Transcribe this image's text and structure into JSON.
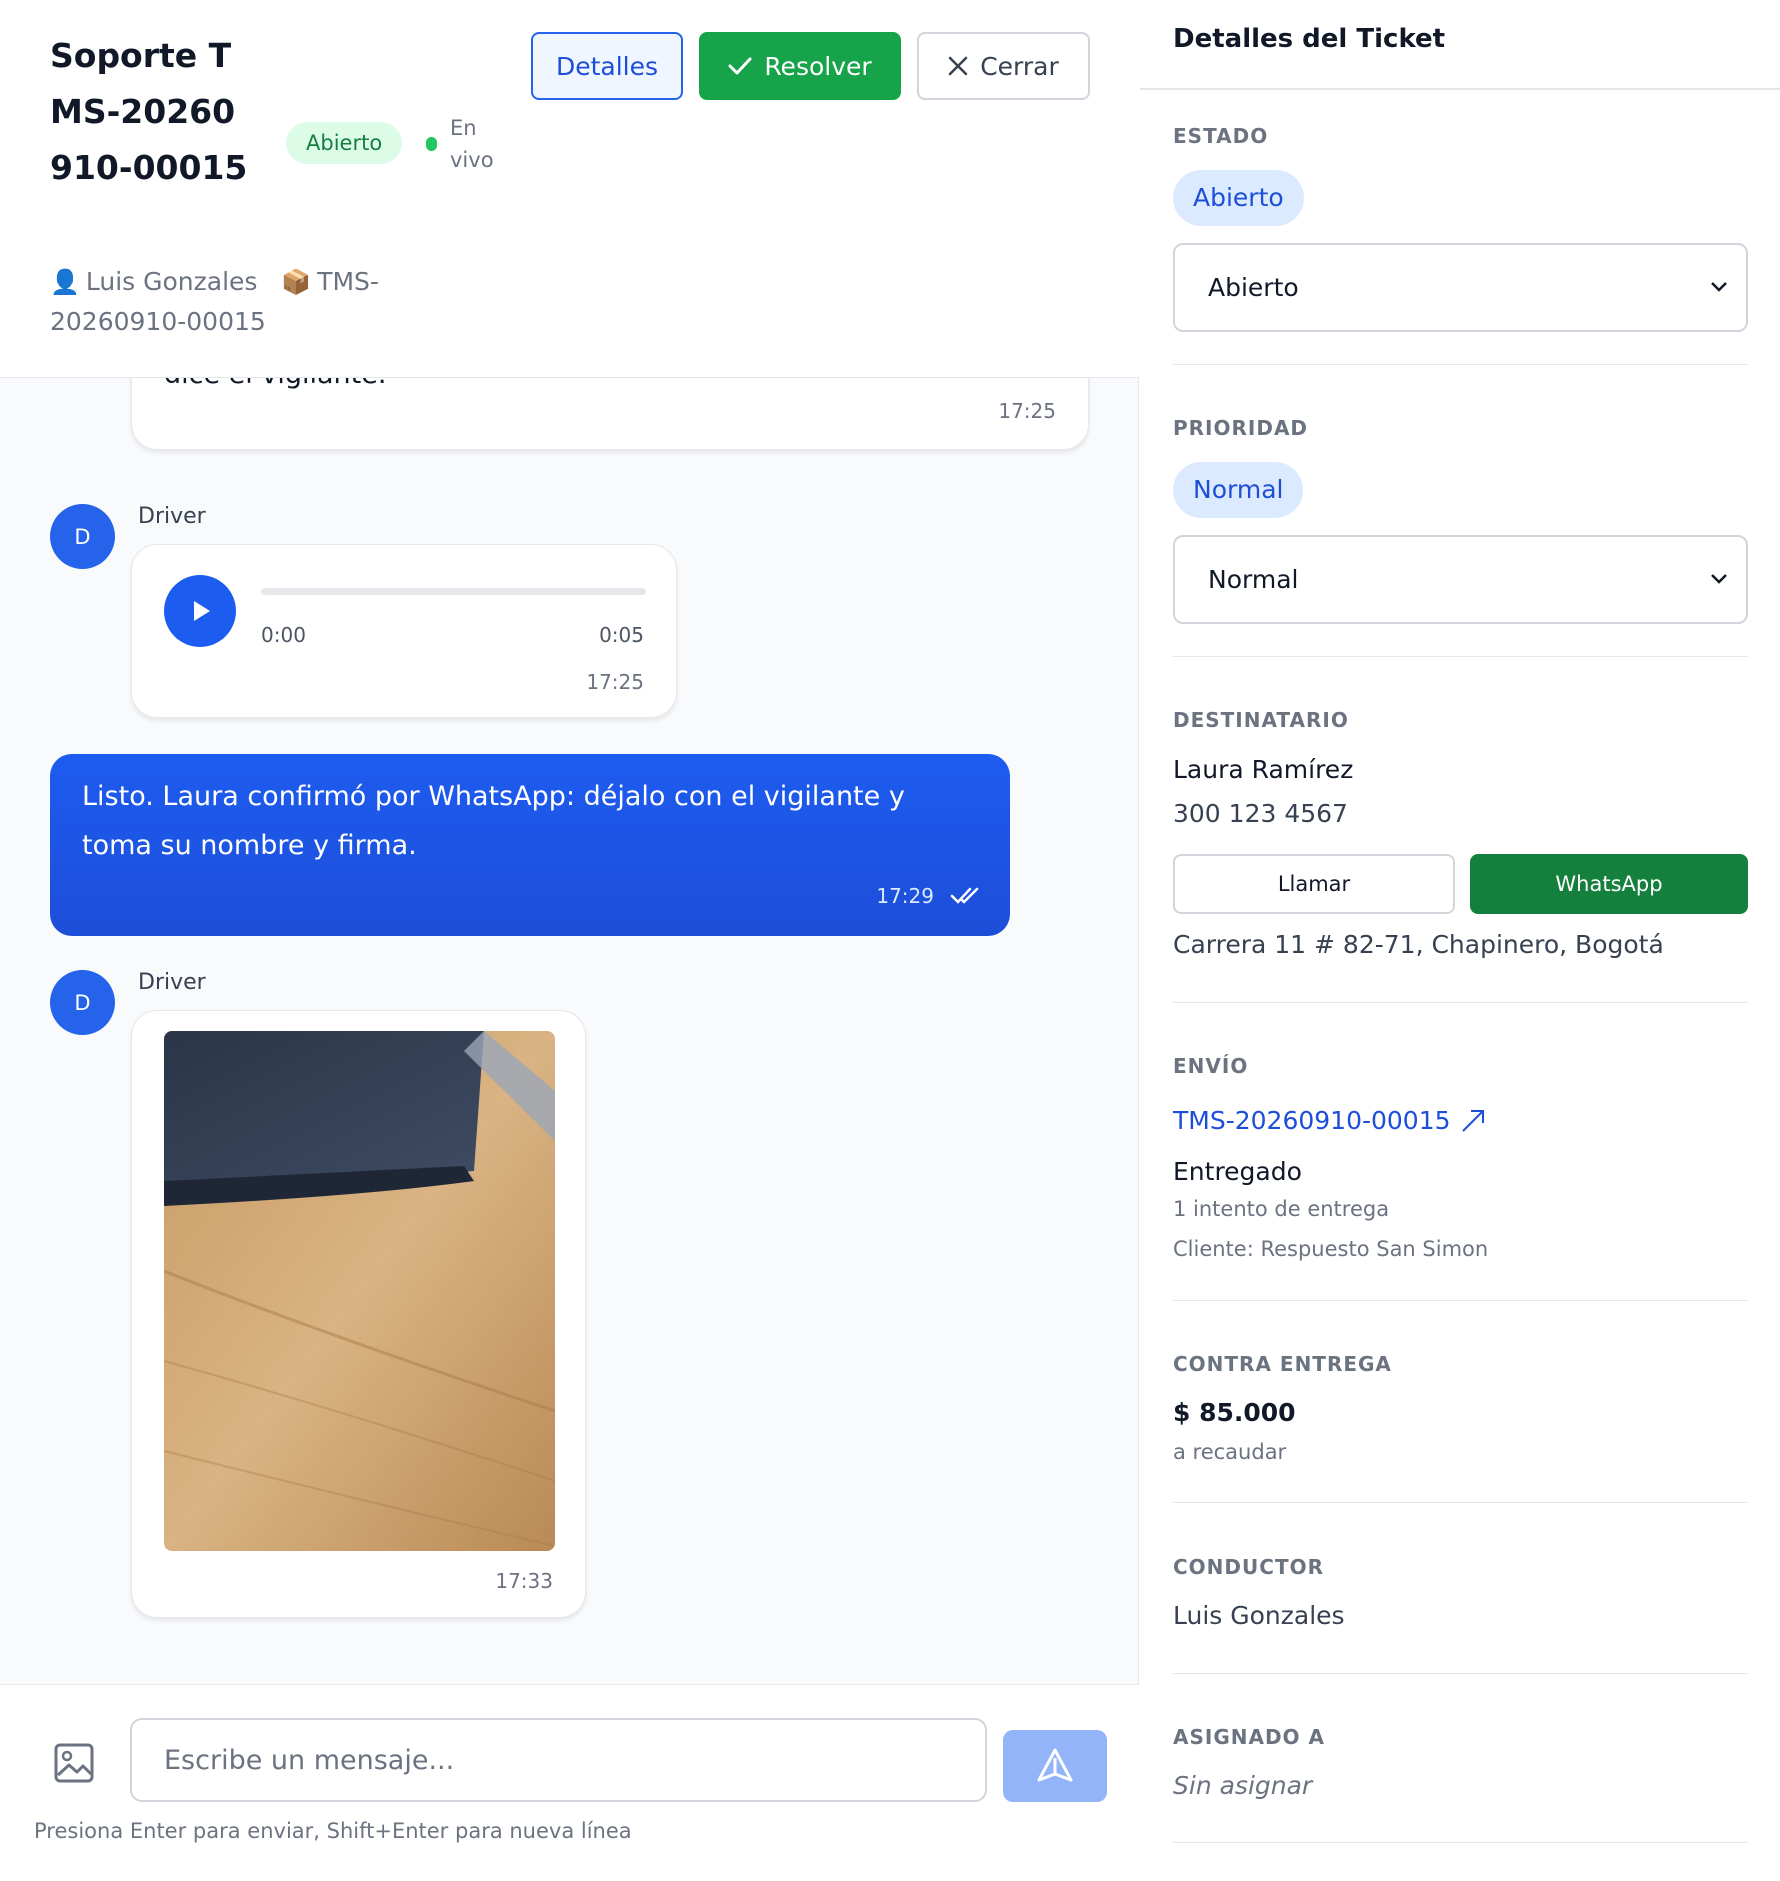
{
  "header": {
    "title": "Soporte TMS-20260910-00015",
    "status_badge": "Abierto",
    "live_label": "En vivo",
    "user_name": "Luis Gonzales",
    "shipment_ref": "TMS-20260910-00015",
    "buttons": {
      "details": "Detalles",
      "resolve": "Resolver",
      "close": "Cerrar"
    }
  },
  "messages": {
    "partial": {
      "text": "dice el vigilante.",
      "time": "17:25"
    },
    "audio": {
      "sender": "Driver",
      "avatar": "D",
      "current": "0:00",
      "duration": "0:05",
      "time": "17:25",
      "progress": 0
    },
    "outgoing": {
      "text": "Listo. Laura confirmó por WhatsApp: déjalo con el vigilante y toma su nombre y firma.",
      "time": "17:29"
    },
    "image": {
      "sender": "Driver",
      "avatar": "D",
      "time": "17:33"
    }
  },
  "composer": {
    "placeholder": "Escribe un mensaje...",
    "hint": "Presiona Enter para enviar, Shift+Enter para nueva línea"
  },
  "panel": {
    "title": "Detalles del Ticket",
    "estado": {
      "label": "ESTADO",
      "pill": "Abierto",
      "select": "Abierto"
    },
    "prioridad": {
      "label": "PRIORIDAD",
      "pill": "Normal",
      "select": "Normal"
    },
    "destinatario": {
      "label": "DESTINATARIO",
      "name": "Laura Ramírez",
      "phone": "300 123 4567",
      "call": "Llamar",
      "whatsapp": "WhatsApp",
      "address": "Carrera 11 # 82-71, Chapinero, Bogotá"
    },
    "envio": {
      "label": "ENVÍO",
      "link": "TMS-20260910-00015",
      "status": "Entregado",
      "attempts": "1 intento de entrega",
      "client": "Cliente: Respuesto San Simon"
    },
    "contra_entrega": {
      "label": "CONTRA ENTREGA",
      "amount": "$ 85.000",
      "note": "a recaudar"
    },
    "conductor": {
      "label": "CONDUCTOR",
      "name": "Luis Gonzales"
    },
    "asignado": {
      "label": "ASIGNADO A",
      "value": "Sin asignar"
    }
  },
  "colors": {
    "primary": "#1d4ed8",
    "success": "#16a34a",
    "whatsapp": "#15803d",
    "badge_open_bg": "#dcfce7",
    "pill_bg": "#dbeafe"
  },
  "icons": [
    "check-icon",
    "close-icon",
    "user-icon",
    "package-icon",
    "play-icon",
    "double-check-icon",
    "image-icon",
    "send-icon",
    "chevron-down-icon",
    "external-link-icon"
  ]
}
